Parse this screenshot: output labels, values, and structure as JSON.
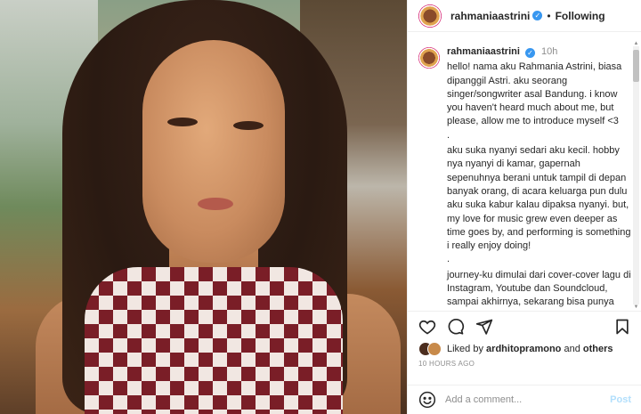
{
  "post": {
    "username": "rahmaniaastrini",
    "follow_status": "Following",
    "separator": "•"
  },
  "caption": {
    "username": "rahmaniaastrini",
    "time": "10h",
    "paragraphs": [
      "hello! nama aku Rahmania Astrini, biasa dipanggil Astri. aku seorang singer/songwriter asal Bandung. i know you haven't heard much about me, but please, allow me to introduce myself <3\n.",
      "aku suka nyanyi sedari aku kecil. hobby nya nyanyi di kamar, gapernah sepenuhnya berani untuk tampil di depan banyak orang, di acara keluarga pun dulu aku suka kabur kalau dipaksa nyanyi. but, my love for music grew even deeper as time goes by, and performing is something i really enjoy doing!\n.",
      "journey-ku dimulai dari cover-cover lagu di Instagram, Youtube dan Soundcloud, sampai akhirnya, sekarang bisa punya lagu lagu sendiri yang aku"
    ]
  },
  "actions": {
    "like_icon": "heart-icon",
    "comment_icon": "comment-icon",
    "share_icon": "paper-plane-icon",
    "save_icon": "bookmark-icon"
  },
  "likes": {
    "prefix": "Liked by",
    "user": "ardhitopramono",
    "conj": "and",
    "others": "others"
  },
  "time_ago": "10 HOURS AGO",
  "comment": {
    "placeholder": "Add a comment...",
    "post_label": "Post"
  },
  "colors": {
    "verified": "#3897f0",
    "post_disabled": "#b2dffc",
    "muted": "#8e8e8e"
  }
}
